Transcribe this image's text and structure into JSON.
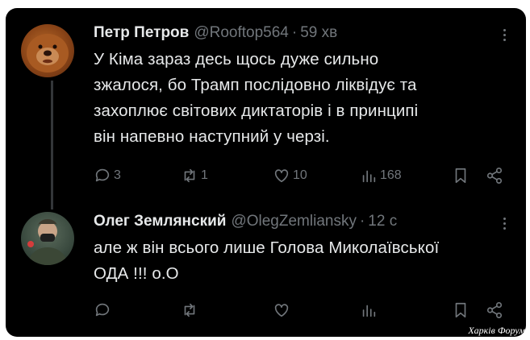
{
  "tweets": [
    {
      "author_name": "Петр Петров",
      "handle": "@Rooftop564",
      "separator": "·",
      "time": "59 хв",
      "text": "У Кіма зараз десь щось дуже сильно\nзжалося, бо Трамп послідовно ліквідує та\nзахоплює світових диктаторів і в принципі\nвін напевно наступний у черзі.",
      "replies": "3",
      "reposts": "1",
      "likes": "10",
      "views": "168"
    },
    {
      "author_name": "Олег Землянский",
      "handle": "@OlegZemliansky",
      "separator": "·",
      "time": "12 с",
      "text": "але ж він всього лише Голова Миколаївської\nОДА !!! о.О",
      "replies": "",
      "reposts": "",
      "likes": "",
      "views": ""
    }
  ],
  "icons": [
    "reply-icon",
    "repost-icon",
    "like-icon",
    "views-icon",
    "bookmark-icon",
    "share-icon",
    "more-icon"
  ],
  "watermark": "Харків Форум",
  "colors": {
    "background": "#000000",
    "text": "#e7e9ea",
    "muted": "#71767b"
  }
}
